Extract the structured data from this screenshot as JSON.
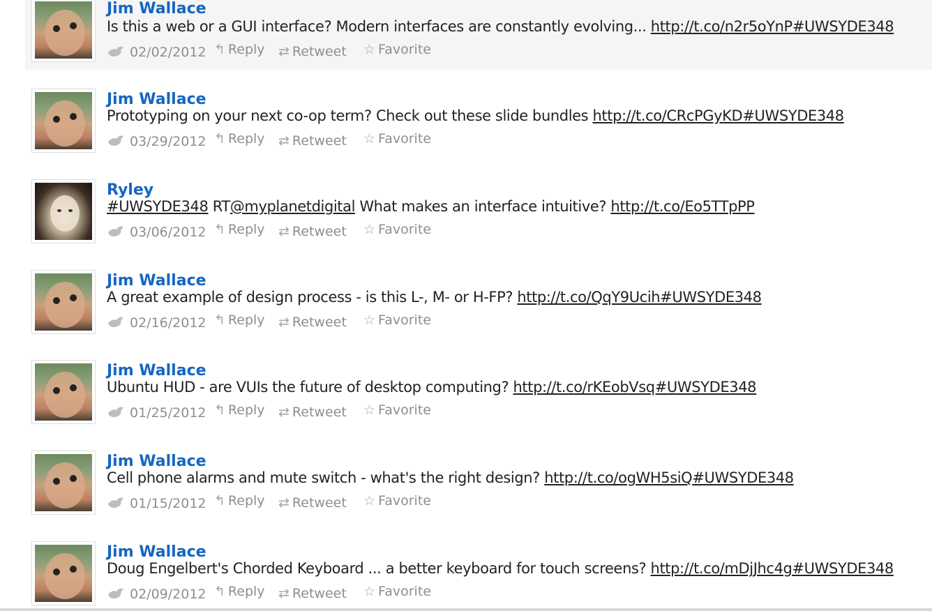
{
  "colors": {
    "name": "#1666c0",
    "text": "#222222",
    "meta": "#8e8e8e",
    "highlight": "#f5f5f5"
  },
  "actions": {
    "reply": "Reply",
    "retweet": "Retweet",
    "favorite": "Favorite"
  },
  "icons": {
    "source": "bird-icon",
    "reply": "reply-arrow-icon",
    "retweet": "retweet-arrows-icon",
    "favorite": "star-icon"
  },
  "tweets": [
    {
      "author": "Jim Wallace",
      "avatar": "man",
      "text": "Is this a web or a GUI interface? Modern interfaces are constantly evolving... ",
      "link": "http://t.co/n2r5oYnP#UWSYDE348",
      "date": "02/02/2012"
    },
    {
      "author": "Jim Wallace",
      "avatar": "man",
      "text": "Prototyping on your next co-op term? Check out these slide bundles ",
      "link": "http://t.co/CRcPGyKD#UWSYDE348",
      "date": "03/29/2012"
    },
    {
      "author": "Ryley",
      "avatar": "woman",
      "hashtag": "#UWSYDE348",
      "rt": " RT",
      "mention": "@myplanetdigital",
      "text": " What makes an interface intuitive? ",
      "link": "http://t.co/Eo5TTpPP",
      "date": "03/06/2012"
    },
    {
      "author": "Jim Wallace",
      "avatar": "man",
      "text": "A great example of design process - is this L-, M- or H-FP? ",
      "link": "http://t.co/QqY9Ucih#UWSYDE348",
      "date": "02/16/2012"
    },
    {
      "author": "Jim Wallace",
      "avatar": "man",
      "text": "Ubuntu HUD - are VUIs the future of desktop computing? ",
      "link": "http://t.co/rKEobVsq#UWSYDE348",
      "date": "01/25/2012"
    },
    {
      "author": "Jim Wallace",
      "avatar": "man",
      "text": "Cell phone alarms and mute switch - what's the right design? ",
      "link": "http://t.co/ogWH5siQ#UWSYDE348",
      "date": "01/15/2012"
    },
    {
      "author": "Jim Wallace",
      "avatar": "man",
      "text": "Doug Engelbert's Chorded Keyboard ... a better keyboard for touch screens? ",
      "link": "http://t.co/mDjJhc4g#UWSYDE348",
      "date": "02/09/2012"
    }
  ]
}
